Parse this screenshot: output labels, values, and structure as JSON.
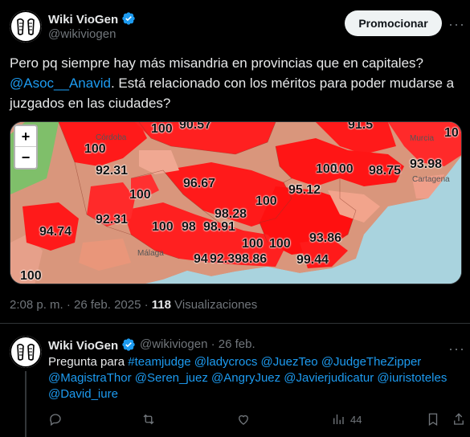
{
  "tweet": {
    "author_name": "Wiki VioGen",
    "author_handle": "@wikiviogen",
    "promote_label": "Promocionar",
    "more_label": "···",
    "text_before": "Pero pq siempre hay más misandria en provincias que en capitales? ",
    "mention": "@Asoc__Anavid",
    "text_after": ". Está relacionado con los méritos para poder mudarse a juzgados en las ciudades?",
    "time": "2:08 p. m. · 26 feb. 2025 · ",
    "views_count": "118",
    "views_label": " Visualizaciones"
  },
  "map": {
    "zoom_in": "+",
    "zoom_out": "−",
    "cities": [
      "Córdoba",
      "Murcia",
      "Cartagena",
      "Málaga"
    ],
    "labels": [
      "100",
      "90.57",
      "91.5",
      "92.31",
      "100",
      "100",
      "96.67",
      "100",
      "95.12",
      "100",
      "98.75",
      "93.98",
      "100",
      "92.31",
      "94.74",
      "100",
      "98",
      "98.91",
      "98.28",
      "100",
      "100",
      "93.86",
      "99.44",
      "94",
      "92.398.86",
      "100",
      "10"
    ]
  },
  "reply": {
    "author_name": "Wiki VioGen",
    "author_handle": "@wikiviogen",
    "date": "· 26 feb.",
    "more_label": "···",
    "prefix": "Pregunta para ",
    "mentions": "#teamjudge @ladycrocs @JuezTeo @JudgeTheZipper @MagistraThor @Seren_juez @AngryJuez @Javierjudicatur @iuristoteles @David_iure",
    "views_count": "44"
  },
  "colors": {
    "accent": "#1d9bf0",
    "verified": "#1d9bf0",
    "map_red": "#ff1a1a",
    "map_salmon": "#e9967a"
  },
  "icons": [
    "verified-icon",
    "more-icon",
    "reply-icon",
    "retweet-icon",
    "like-icon",
    "views-icon",
    "bookmark-icon",
    "share-icon"
  ]
}
